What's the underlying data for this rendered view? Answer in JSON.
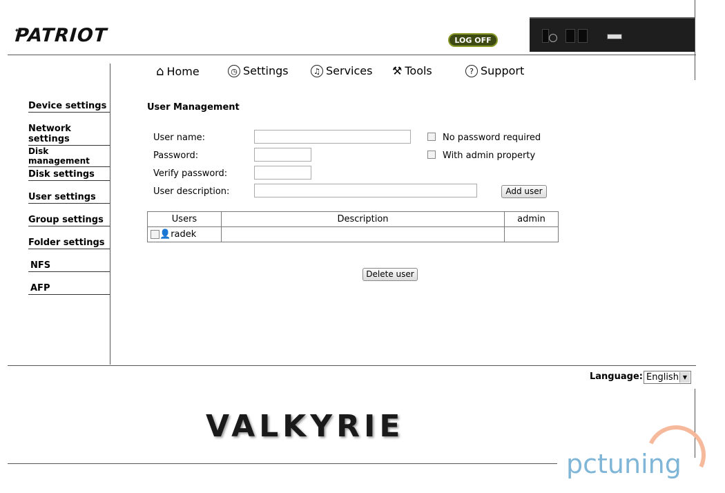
{
  "header": {
    "logo": "PATRIOT",
    "logoff_label": "LOG OFF"
  },
  "nav": {
    "items": [
      {
        "label": "Home",
        "icon": "home-icon"
      },
      {
        "label": "Settings",
        "icon": "clock-icon"
      },
      {
        "label": "Services",
        "icon": "music-note-icon"
      },
      {
        "label": "Tools",
        "icon": "tools-icon"
      },
      {
        "label": "Support",
        "icon": "help-icon"
      }
    ]
  },
  "sidebar": {
    "items": [
      {
        "label": "Device settings"
      },
      {
        "label": "Network settings"
      },
      {
        "label": "Disk management"
      },
      {
        "label": "Disk settings"
      },
      {
        "label": "User settings"
      },
      {
        "label": "Group settings"
      },
      {
        "label": "Folder settings"
      },
      {
        "label": "NFS"
      },
      {
        "label": "AFP"
      }
    ]
  },
  "form": {
    "title": "User Management",
    "username_label": "User name:",
    "username_value": "",
    "password_label": "Password:",
    "password_value": "",
    "verify_label": "Verify password:",
    "verify_value": "",
    "description_label": "User description:",
    "description_value": "",
    "no_password_label": "No password required",
    "admin_property_label": "With admin property",
    "add_user_label": "Add user"
  },
  "table": {
    "headers": [
      "Users",
      "Description",
      "admin"
    ],
    "rows": [
      {
        "user": "radek",
        "description": "",
        "admin": ""
      }
    ]
  },
  "delete_user_label": "Delete user",
  "footer": {
    "language_label": "Language:",
    "language_value": "English",
    "banner_text": "VALKYRIE",
    "watermark": "pctuning"
  }
}
